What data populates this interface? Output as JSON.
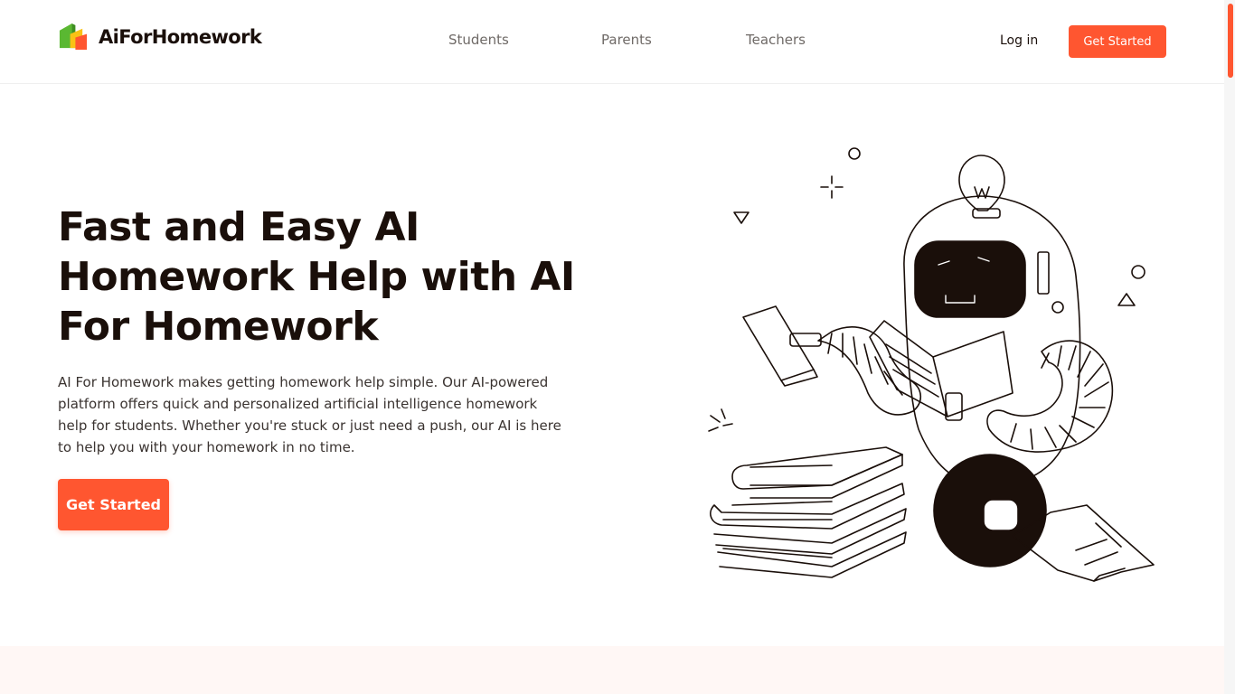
{
  "brand": {
    "name": "AiForHomework",
    "colors": {
      "primary": "#ff5630",
      "logo_green": "#5ab832",
      "logo_yellow": "#f9c215",
      "text": "#1a0f0a"
    }
  },
  "nav": {
    "links": [
      {
        "label": "Students"
      },
      {
        "label": "Parents"
      },
      {
        "label": "Teachers"
      }
    ],
    "login_label": "Log in",
    "cta_label": "Get Started"
  },
  "hero": {
    "title": "Fast and Easy AI Homework Help with AI For Homework",
    "description": "AI For Homework makes getting homework help simple. Our AI-powered platform offers quick and personalized artificial intelligence homework help for students. Whether you're stuck or just need a push, our AI is here to help you with your homework in no time.",
    "cta_label": "Get Started",
    "illustration": "robot-reading-books-illustration"
  }
}
